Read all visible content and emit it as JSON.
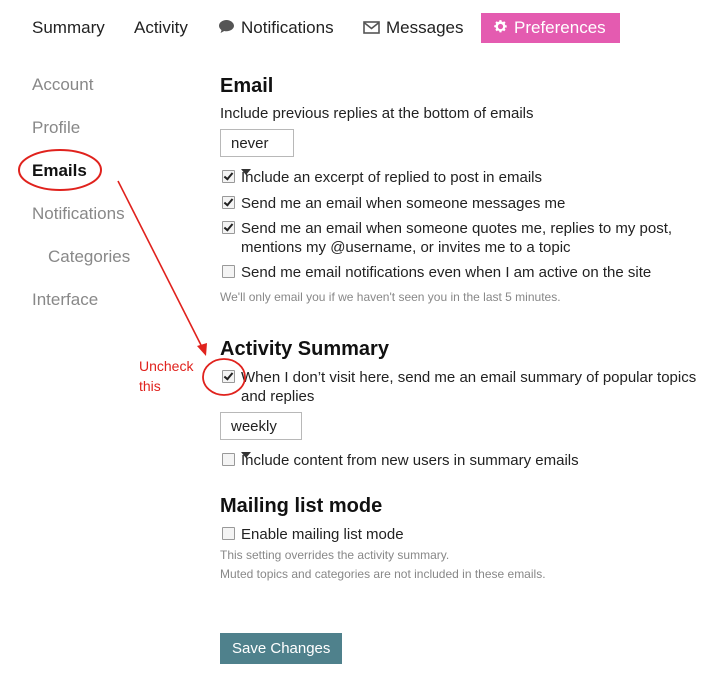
{
  "topnav": {
    "summary": "Summary",
    "activity": "Activity",
    "notifications": "Notifications",
    "messages": "Messages",
    "preferences": "Preferences",
    "active_color": "#e45bb0"
  },
  "sidebar": {
    "items": [
      {
        "label": "Account"
      },
      {
        "label": "Profile"
      },
      {
        "label": "Emails"
      },
      {
        "label": "Notifications"
      },
      {
        "label": "Categories"
      },
      {
        "label": "Interface"
      }
    ]
  },
  "email": {
    "heading": "Email",
    "previous_replies_label": "Include previous replies at the bottom of emails",
    "previous_replies_value": "never",
    "options": [
      {
        "label": "Include an excerpt of replied to post in emails",
        "checked": true
      },
      {
        "label": "Send me an email when someone messages me",
        "checked": true
      },
      {
        "label": "Send me an email when someone quotes me, replies to my post, mentions my @username, or invites me to a topic",
        "checked": true
      },
      {
        "label": "Send me email notifications even when I am active on the site",
        "checked": false
      }
    ],
    "hint": "We'll only email you if we haven't seen you in the last 5 minutes."
  },
  "activity_summary": {
    "heading": "Activity Summary",
    "digest_label": "When I don’t visit here, send me an email summary of popular topics and replies",
    "digest_checked": true,
    "frequency_value": "weekly",
    "new_users_label": "Include content from new users in summary emails",
    "new_users_checked": false
  },
  "mailing_list": {
    "heading": "Mailing list mode",
    "enable_label": "Enable mailing list mode",
    "enable_checked": false,
    "hint_1": "This setting overrides the activity summary.",
    "hint_2": "Muted topics and categories are not included in these emails."
  },
  "actions": {
    "save_label": "Save Changes",
    "save_color": "#4f818c"
  },
  "annotation": {
    "line_1": "Uncheck",
    "line_2": "this",
    "color": "#e0221d"
  }
}
